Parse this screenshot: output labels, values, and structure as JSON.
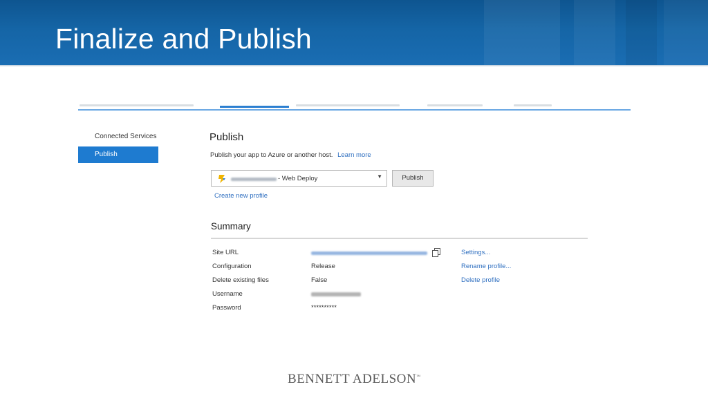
{
  "slide": {
    "title": "Finalize and Publish",
    "footer_logo": "BENNETT ADELSON",
    "footer_tm": "™"
  },
  "colors": {
    "header_blue": "#1565a6",
    "accent_blue": "#1e7bd0",
    "link_blue": "#2f6fc0"
  },
  "sidebar": {
    "items": [
      {
        "label": "Connected Services",
        "active": false
      },
      {
        "label": "Publish",
        "active": true
      }
    ]
  },
  "publish": {
    "heading": "Publish",
    "description": "Publish your app to Azure or another host.",
    "learn_more": "Learn more",
    "profile_select": {
      "selected_suffix": "- Web Deploy",
      "icon": "web-deploy-icon"
    },
    "publish_button": "Publish",
    "create_profile": "Create new profile"
  },
  "summary": {
    "heading": "Summary",
    "rows": [
      {
        "label": "Site URL",
        "value": "",
        "action": "Settings..."
      },
      {
        "label": "Configuration",
        "value": "Release",
        "action": "Rename profile..."
      },
      {
        "label": "Delete existing files",
        "value": "False",
        "action": "Delete profile"
      },
      {
        "label": "Username",
        "value": "",
        "action": ""
      },
      {
        "label": "Password",
        "value": "**********",
        "action": ""
      }
    ]
  }
}
